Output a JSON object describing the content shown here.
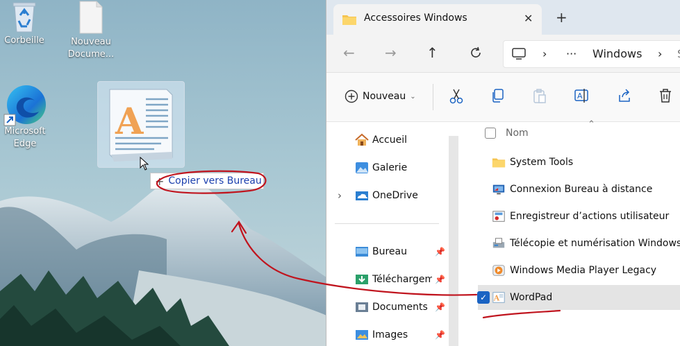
{
  "desktop": {
    "icons": [
      {
        "label": "Corbeille",
        "icon": "recycle-bin-icon"
      },
      {
        "label": "Nouveau Docume...",
        "icon": "blank-document-icon"
      },
      {
        "label": "Microsoft Edge",
        "icon": "edge-icon"
      }
    ],
    "drag_ghost_icon": "wordpad-icon",
    "copy_tooltip": {
      "prefix": "+",
      "label": "Copier vers Bureau"
    }
  },
  "explorer": {
    "tab_title": "Accessoires Windows",
    "tab_close": "✕",
    "new_tab": "+",
    "breadcrumb": {
      "more": "···",
      "segment": "Windows",
      "next": "S"
    },
    "toolbar": {
      "new_label": "Nouveau"
    },
    "nav": {
      "top": [
        {
          "label": "Accueil",
          "icon": "home-icon"
        },
        {
          "label": "Galerie",
          "icon": "gallery-icon"
        },
        {
          "label": "OneDrive",
          "icon": "onedrive-icon"
        }
      ],
      "pinned": [
        {
          "label": "Bureau",
          "icon": "desktop-folder-icon"
        },
        {
          "label": "Téléchargements",
          "icon": "downloads-folder-icon"
        },
        {
          "label": "Documents",
          "icon": "documents-folder-icon"
        },
        {
          "label": "Images",
          "icon": "pictures-folder-icon"
        }
      ]
    },
    "column_header": "Nom",
    "files": [
      {
        "name": "System Tools",
        "icon": "folder-icon"
      },
      {
        "name": "Connexion Bureau à distance",
        "icon": "remote-desktop-icon"
      },
      {
        "name": "Enregistreur d’actions utilisateur",
        "icon": "steps-recorder-icon"
      },
      {
        "name": "Télécopie et numérisation Windows",
        "icon": "fax-scan-icon"
      },
      {
        "name": "Windows Media Player Legacy",
        "icon": "media-player-icon"
      },
      {
        "name": "WordPad",
        "icon": "wordpad-icon",
        "selected": true
      }
    ]
  },
  "colors": {
    "annotation": "#c0141e",
    "accent": "#1a63c3"
  }
}
